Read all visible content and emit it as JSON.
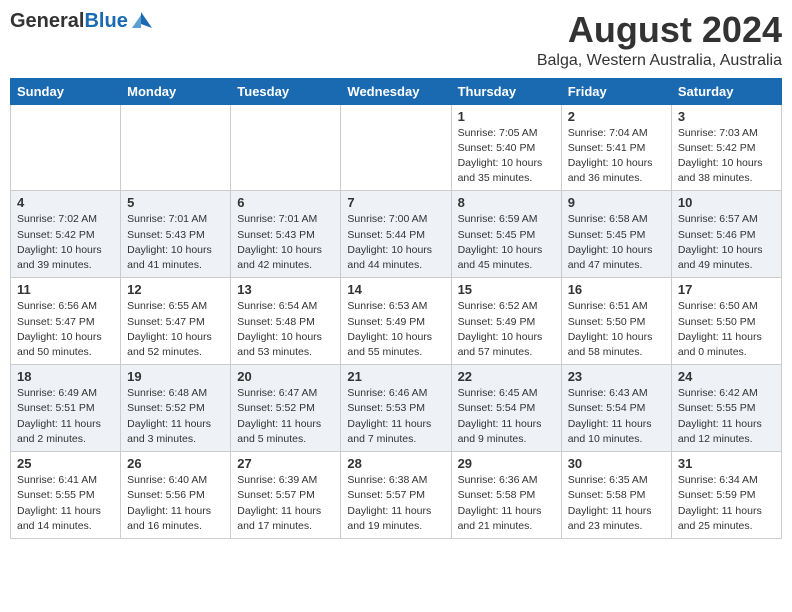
{
  "header": {
    "logo_general": "General",
    "logo_blue": "Blue",
    "month_year": "August 2024",
    "location": "Balga, Western Australia, Australia"
  },
  "days_of_week": [
    "Sunday",
    "Monday",
    "Tuesday",
    "Wednesday",
    "Thursday",
    "Friday",
    "Saturday"
  ],
  "weeks": [
    [
      {
        "day": "",
        "sunrise": "",
        "sunset": "",
        "daylight": ""
      },
      {
        "day": "",
        "sunrise": "",
        "sunset": "",
        "daylight": ""
      },
      {
        "day": "",
        "sunrise": "",
        "sunset": "",
        "daylight": ""
      },
      {
        "day": "",
        "sunrise": "",
        "sunset": "",
        "daylight": ""
      },
      {
        "day": "1",
        "sunrise": "Sunrise: 7:05 AM",
        "sunset": "Sunset: 5:40 PM",
        "daylight": "Daylight: 10 hours and 35 minutes."
      },
      {
        "day": "2",
        "sunrise": "Sunrise: 7:04 AM",
        "sunset": "Sunset: 5:41 PM",
        "daylight": "Daylight: 10 hours and 36 minutes."
      },
      {
        "day": "3",
        "sunrise": "Sunrise: 7:03 AM",
        "sunset": "Sunset: 5:42 PM",
        "daylight": "Daylight: 10 hours and 38 minutes."
      }
    ],
    [
      {
        "day": "4",
        "sunrise": "Sunrise: 7:02 AM",
        "sunset": "Sunset: 5:42 PM",
        "daylight": "Daylight: 10 hours and 39 minutes."
      },
      {
        "day": "5",
        "sunrise": "Sunrise: 7:01 AM",
        "sunset": "Sunset: 5:43 PM",
        "daylight": "Daylight: 10 hours and 41 minutes."
      },
      {
        "day": "6",
        "sunrise": "Sunrise: 7:01 AM",
        "sunset": "Sunset: 5:43 PM",
        "daylight": "Daylight: 10 hours and 42 minutes."
      },
      {
        "day": "7",
        "sunrise": "Sunrise: 7:00 AM",
        "sunset": "Sunset: 5:44 PM",
        "daylight": "Daylight: 10 hours and 44 minutes."
      },
      {
        "day": "8",
        "sunrise": "Sunrise: 6:59 AM",
        "sunset": "Sunset: 5:45 PM",
        "daylight": "Daylight: 10 hours and 45 minutes."
      },
      {
        "day": "9",
        "sunrise": "Sunrise: 6:58 AM",
        "sunset": "Sunset: 5:45 PM",
        "daylight": "Daylight: 10 hours and 47 minutes."
      },
      {
        "day": "10",
        "sunrise": "Sunrise: 6:57 AM",
        "sunset": "Sunset: 5:46 PM",
        "daylight": "Daylight: 10 hours and 49 minutes."
      }
    ],
    [
      {
        "day": "11",
        "sunrise": "Sunrise: 6:56 AM",
        "sunset": "Sunset: 5:47 PM",
        "daylight": "Daylight: 10 hours and 50 minutes."
      },
      {
        "day": "12",
        "sunrise": "Sunrise: 6:55 AM",
        "sunset": "Sunset: 5:47 PM",
        "daylight": "Daylight: 10 hours and 52 minutes."
      },
      {
        "day": "13",
        "sunrise": "Sunrise: 6:54 AM",
        "sunset": "Sunset: 5:48 PM",
        "daylight": "Daylight: 10 hours and 53 minutes."
      },
      {
        "day": "14",
        "sunrise": "Sunrise: 6:53 AM",
        "sunset": "Sunset: 5:49 PM",
        "daylight": "Daylight: 10 hours and 55 minutes."
      },
      {
        "day": "15",
        "sunrise": "Sunrise: 6:52 AM",
        "sunset": "Sunset: 5:49 PM",
        "daylight": "Daylight: 10 hours and 57 minutes."
      },
      {
        "day": "16",
        "sunrise": "Sunrise: 6:51 AM",
        "sunset": "Sunset: 5:50 PM",
        "daylight": "Daylight: 10 hours and 58 minutes."
      },
      {
        "day": "17",
        "sunrise": "Sunrise: 6:50 AM",
        "sunset": "Sunset: 5:50 PM",
        "daylight": "Daylight: 11 hours and 0 minutes."
      }
    ],
    [
      {
        "day": "18",
        "sunrise": "Sunrise: 6:49 AM",
        "sunset": "Sunset: 5:51 PM",
        "daylight": "Daylight: 11 hours and 2 minutes."
      },
      {
        "day": "19",
        "sunrise": "Sunrise: 6:48 AM",
        "sunset": "Sunset: 5:52 PM",
        "daylight": "Daylight: 11 hours and 3 minutes."
      },
      {
        "day": "20",
        "sunrise": "Sunrise: 6:47 AM",
        "sunset": "Sunset: 5:52 PM",
        "daylight": "Daylight: 11 hours and 5 minutes."
      },
      {
        "day": "21",
        "sunrise": "Sunrise: 6:46 AM",
        "sunset": "Sunset: 5:53 PM",
        "daylight": "Daylight: 11 hours and 7 minutes."
      },
      {
        "day": "22",
        "sunrise": "Sunrise: 6:45 AM",
        "sunset": "Sunset: 5:54 PM",
        "daylight": "Daylight: 11 hours and 9 minutes."
      },
      {
        "day": "23",
        "sunrise": "Sunrise: 6:43 AM",
        "sunset": "Sunset: 5:54 PM",
        "daylight": "Daylight: 11 hours and 10 minutes."
      },
      {
        "day": "24",
        "sunrise": "Sunrise: 6:42 AM",
        "sunset": "Sunset: 5:55 PM",
        "daylight": "Daylight: 11 hours and 12 minutes."
      }
    ],
    [
      {
        "day": "25",
        "sunrise": "Sunrise: 6:41 AM",
        "sunset": "Sunset: 5:55 PM",
        "daylight": "Daylight: 11 hours and 14 minutes."
      },
      {
        "day": "26",
        "sunrise": "Sunrise: 6:40 AM",
        "sunset": "Sunset: 5:56 PM",
        "daylight": "Daylight: 11 hours and 16 minutes."
      },
      {
        "day": "27",
        "sunrise": "Sunrise: 6:39 AM",
        "sunset": "Sunset: 5:57 PM",
        "daylight": "Daylight: 11 hours and 17 minutes."
      },
      {
        "day": "28",
        "sunrise": "Sunrise: 6:38 AM",
        "sunset": "Sunset: 5:57 PM",
        "daylight": "Daylight: 11 hours and 19 minutes."
      },
      {
        "day": "29",
        "sunrise": "Sunrise: 6:36 AM",
        "sunset": "Sunset: 5:58 PM",
        "daylight": "Daylight: 11 hours and 21 minutes."
      },
      {
        "day": "30",
        "sunrise": "Sunrise: 6:35 AM",
        "sunset": "Sunset: 5:58 PM",
        "daylight": "Daylight: 11 hours and 23 minutes."
      },
      {
        "day": "31",
        "sunrise": "Sunrise: 6:34 AM",
        "sunset": "Sunset: 5:59 PM",
        "daylight": "Daylight: 11 hours and 25 minutes."
      }
    ]
  ]
}
